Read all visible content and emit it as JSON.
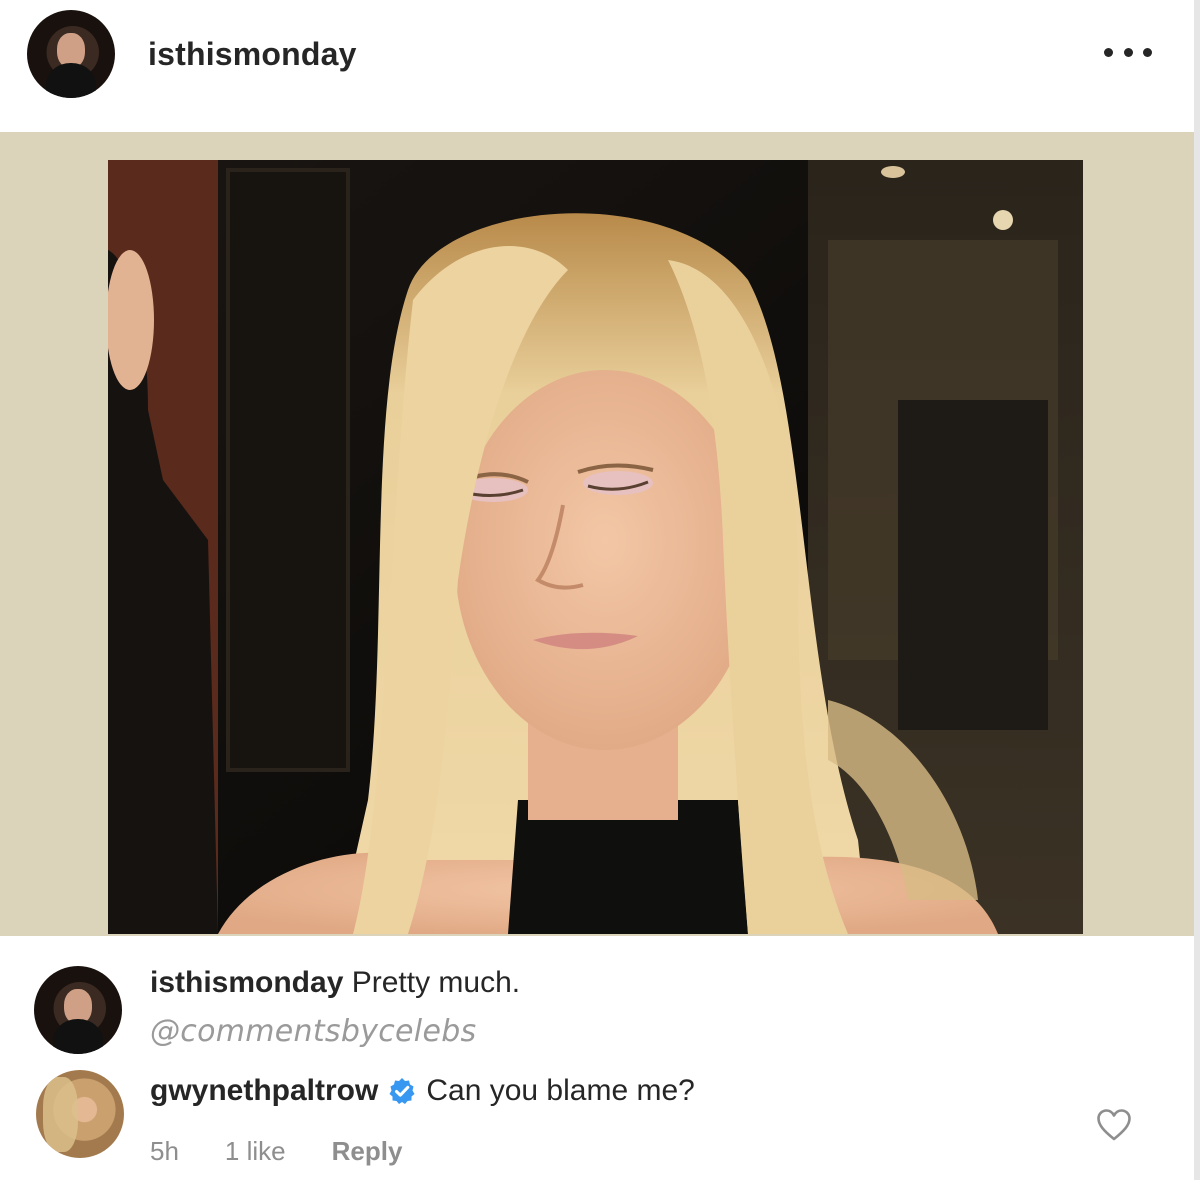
{
  "post": {
    "username": "isthismonday",
    "more_icon": "more-horizontal-icon"
  },
  "caption": {
    "username": "isthismonday",
    "text": "Pretty much.",
    "watermark": "@commentsbycelebs"
  },
  "reply_comment": {
    "username": "gwynethpaltrow",
    "verified_icon": "verified-badge-icon",
    "text": "Can you blame me?",
    "time": "5h",
    "likes": "1 like",
    "reply_label": "Reply",
    "like_icon": "heart-outline-icon"
  },
  "colors": {
    "post_border_bg": "#dcd3bb",
    "verified_blue": "#3897f0",
    "meta_gray": "#8e8e8e"
  }
}
